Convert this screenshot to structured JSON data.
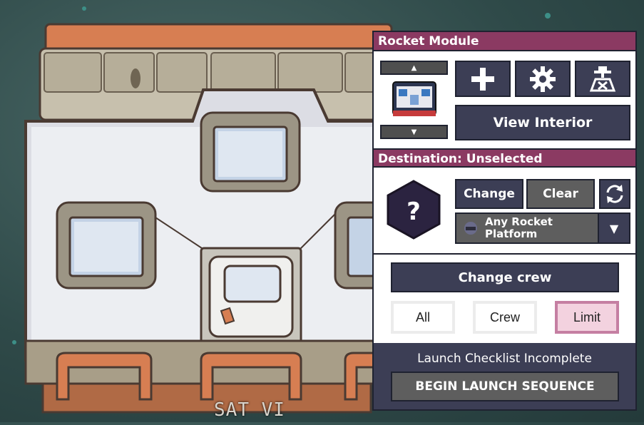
{
  "rocket": {
    "label": "SAT VI"
  },
  "panel": {
    "module_header": "Rocket Module",
    "view_interior_label": "View Interior",
    "add_module_icon": "plus-icon",
    "settings_icon": "gear-icon",
    "platform_icon": "launch-pad-icon",
    "destination_header": "Destination: Unselected",
    "destination_icon": "question-mark-icon",
    "change_label": "Change",
    "clear_label": "Clear",
    "refresh_icon": "refresh-icon",
    "platform_select": "Any Rocket Platform",
    "change_crew_label": "Change crew",
    "crew_filters": [
      "All",
      "Crew",
      "Limit"
    ],
    "crew_filter_active": "Limit",
    "launch_status": "Launch Checklist Incomplete",
    "launch_button_label": "BEGIN LAUNCH SEQUENCE"
  },
  "colors": {
    "header": "#8b3a62",
    "button": "#3c3e55",
    "active_filter": "#f3d2df"
  }
}
